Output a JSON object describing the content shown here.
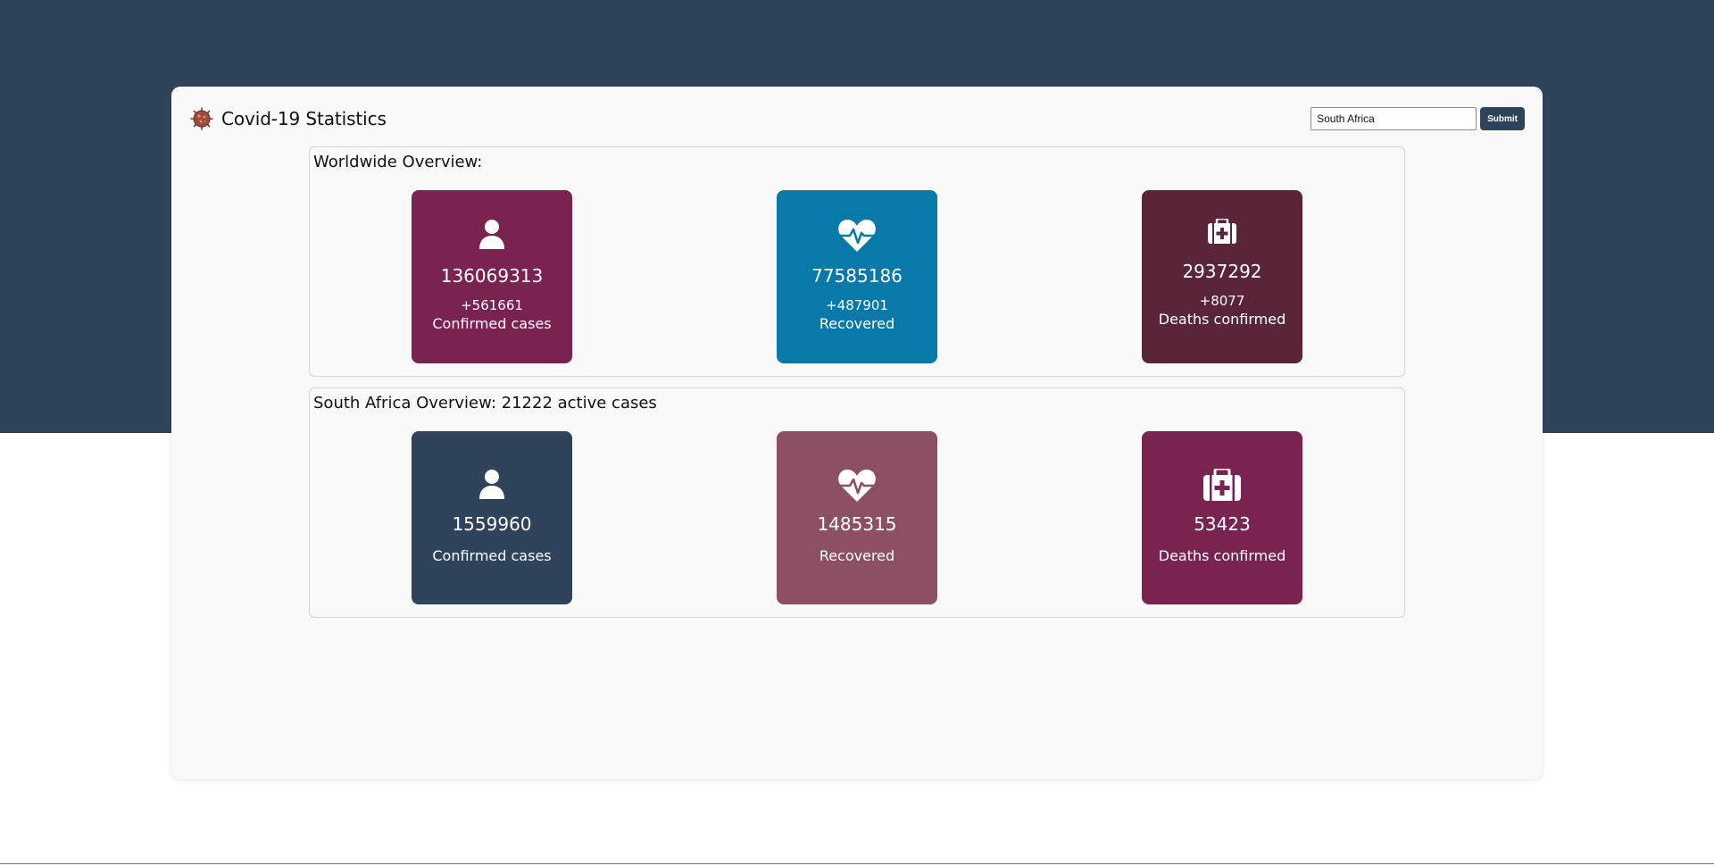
{
  "app": {
    "title": "Covid-19 Statistics"
  },
  "search": {
    "value": "South Africa",
    "placeholder": "",
    "submit_label": "Submit"
  },
  "worldwide": {
    "title": "Worldwide Overview:",
    "tiles": [
      {
        "value": "136069313",
        "delta": "+561661",
        "label": "Confirmed cases",
        "color": "#7a2350",
        "icon": "person-icon"
      },
      {
        "value": "77585186",
        "delta": "+487901",
        "label": "Recovered",
        "color": "#0879a8",
        "icon": "heartbeat-icon"
      },
      {
        "value": "2937292",
        "delta": "+8077",
        "label": "Deaths confirmed",
        "color": "#5a2439",
        "icon": "medkit-icon"
      }
    ]
  },
  "country": {
    "title": "South Africa Overview: 21222 active cases",
    "tiles": [
      {
        "value": "1559960",
        "label": "Confirmed cases",
        "color": "#2f435b",
        "icon": "person-icon"
      },
      {
        "value": "1485315",
        "label": "Recovered",
        "color": "#8c5062",
        "icon": "heartbeat-icon"
      },
      {
        "value": "53423",
        "label": "Deaths confirmed",
        "color": "#7a2350",
        "icon": "medkit-icon"
      }
    ]
  },
  "colors": {
    "band": "#2f435b",
    "card_bg": "#f9f9f9"
  }
}
